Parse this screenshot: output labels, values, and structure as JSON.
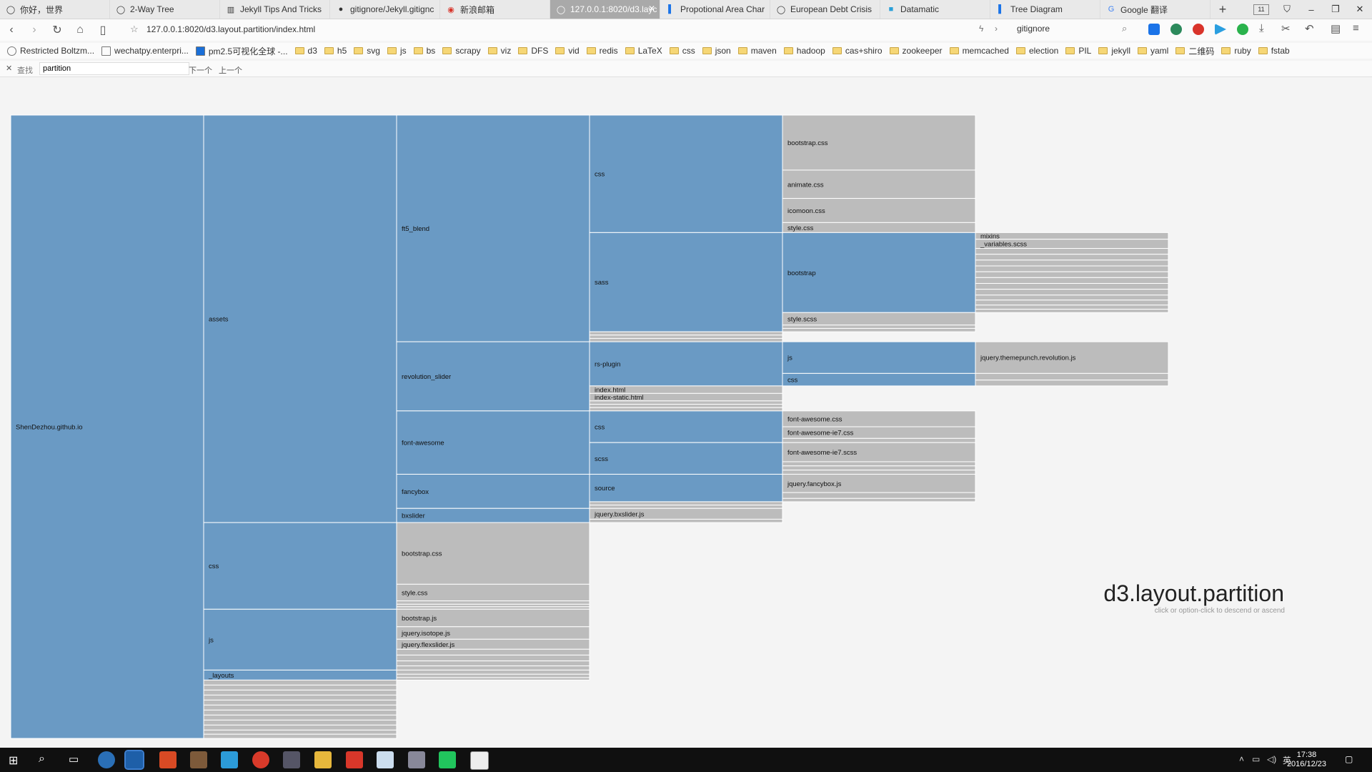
{
  "browser": {
    "tabs": [
      {
        "label": "你好，世界",
        "icon": "globe-icon"
      },
      {
        "label": "2-Way Tree",
        "icon": "globe-icon"
      },
      {
        "label": "Jekyll Tips And Tricks",
        "icon": "book-icon"
      },
      {
        "label": "gitignore/Jekyll.gitignc",
        "icon": "github-icon"
      },
      {
        "label": "新浪邮箱",
        "icon": "weibo-icon"
      },
      {
        "label": "127.0.0.1:8020/d3.layc",
        "icon": "globe-icon",
        "active": true
      },
      {
        "label": "Propotional Area Char",
        "icon": "chart-icon"
      },
      {
        "label": "European Debt Crisis",
        "icon": "globe-icon"
      },
      {
        "label": "Datamatic",
        "icon": "square-icon"
      },
      {
        "label": "Tree Diagram",
        "icon": "chart-icon"
      },
      {
        "label": "Google 翻译",
        "icon": "translate-icon"
      }
    ],
    "tab_count": "11",
    "url": "127.0.0.1:8020/d3.layout.partition/index.html",
    "search_value": "gitignore",
    "bookmarks": [
      "Restricted Boltzm...",
      "wechatpy.enterpri...",
      "pm2.5可视化全球 -...",
      "d3",
      "h5",
      "svg",
      "js",
      "bs",
      "scrapy",
      "viz",
      "DFS",
      "vid",
      "redis",
      "LaTeX",
      "css",
      "json",
      "maven",
      "hadoop",
      "cas+shiro",
      "zookeeper",
      "memcached",
      "election",
      "PIL",
      "jekyll",
      "yaml",
      "二维码",
      "ruby",
      "fstab"
    ]
  },
  "findbar": {
    "label": "查找",
    "value": "partition",
    "next": "下一个",
    "prev": "上一个"
  },
  "page": {
    "title": "d3.layout.partition",
    "subtitle": "click or option-click to descend or ascend"
  },
  "colors": {
    "folder": "#6a9ac4",
    "file": "#bcbcbc",
    "separator": "#ffffff"
  },
  "chart_data": {
    "type": "partition",
    "tree": {
      "name": "ShenDezhou.github.io",
      "children": [
        {
          "name": "assets",
          "children": [
            {
              "name": "ft5_blend",
              "children": [
                {
                  "name": "css",
                  "children": [
                    {
                      "name": "bootstrap.css",
                      "size": 66
                    },
                    {
                      "name": "animate.css",
                      "size": 34
                    },
                    {
                      "name": "icomoon.css",
                      "size": 29
                    },
                    {
                      "name": "style.css",
                      "size": 12
                    }
                  ]
                },
                {
                  "name": "sass",
                  "children": [
                    {
                      "name": "bootstrap",
                      "children": [
                        {
                          "name": "mixins",
                          "size": 8
                        },
                        {
                          "name": "_variables.scss",
                          "size": 11
                        },
                        {
                          "name": "",
                          "size": 7
                        },
                        {
                          "name": "",
                          "size": 7
                        },
                        {
                          "name": "",
                          "size": 7
                        },
                        {
                          "name": "",
                          "size": 7
                        },
                        {
                          "name": "",
                          "size": 7
                        },
                        {
                          "name": "",
                          "size": 7
                        },
                        {
                          "name": "",
                          "size": 7
                        },
                        {
                          "name": "",
                          "size": 7
                        },
                        {
                          "name": "",
                          "size": 6
                        },
                        {
                          "name": "",
                          "size": 6
                        },
                        {
                          "name": "",
                          "size": 5
                        },
                        {
                          "name": "",
                          "size": 4
                        }
                      ]
                    },
                    {
                      "name": "style.scss",
                      "size": 15
                    },
                    {
                      "name": "",
                      "size": 4
                    },
                    {
                      "name": "",
                      "size": 4
                    }
                  ]
                },
                {
                  "name": "",
                  "size": 4
                },
                {
                  "name": "",
                  "size": 4
                },
                {
                  "name": "",
                  "size": 4
                }
              ]
            },
            {
              "name": "revolution_slider",
              "children": [
                {
                  "name": "rs-plugin",
                  "children": [
                    {
                      "name": "js",
                      "children": [
                        {
                          "name": "jquery.themepunch.revolution.js",
                          "size": 38
                        }
                      ]
                    },
                    {
                      "name": "css",
                      "children": [
                        {
                          "name": "",
                          "size": 8
                        },
                        {
                          "name": "",
                          "size": 7
                        }
                      ]
                    }
                  ]
                },
                {
                  "name": "index.html",
                  "size": 9
                },
                {
                  "name": "index-static.html",
                  "size": 9
                },
                {
                  "name": "",
                  "size": 4
                },
                {
                  "name": "",
                  "size": 4
                },
                {
                  "name": "",
                  "size": 4
                }
              ]
            },
            {
              "name": "font-awesome",
              "children": [
                {
                  "name": "css",
                  "children": [
                    {
                      "name": "font-awesome.css",
                      "size": 19
                    },
                    {
                      "name": "font-awesome-ie7.css",
                      "size": 14
                    },
                    {
                      "name": "",
                      "size": 5
                    }
                  ]
                },
                {
                  "name": "scss",
                  "children": [
                    {
                      "name": "font-awesome-ie7.scss",
                      "size": 23
                    },
                    {
                      "name": "",
                      "size": 5
                    },
                    {
                      "name": "",
                      "size": 5
                    },
                    {
                      "name": "",
                      "size": 5
                    }
                  ]
                }
              ]
            },
            {
              "name": "fancybox",
              "children": [
                {
                  "name": "source",
                  "children": [
                    {
                      "name": "jquery.fancybox.js",
                      "size": 22
                    },
                    {
                      "name": "",
                      "size": 7
                    },
                    {
                      "name": "",
                      "size": 4
                    }
                  ]
                },
                {
                  "name": "",
                  "size": 4
                },
                {
                  "name": "",
                  "size": 4
                }
              ]
            },
            {
              "name": "bxslider",
              "children": [
                {
                  "name": "jquery.bxslider.js",
                  "size": 13
                },
                {
                  "name": "",
                  "size": 4
                }
              ]
            }
          ]
        },
        {
          "name": "css",
          "children": [
            {
              "name": "bootstrap.css",
              "size": 74
            },
            {
              "name": "style.css",
              "size": 20
            },
            {
              "name": "",
              "size": 4
            },
            {
              "name": "",
              "size": 3
            },
            {
              "name": "",
              "size": 3
            }
          ]
        },
        {
          "name": "js",
          "children": [
            {
              "name": "bootstrap.js",
              "size": 21
            },
            {
              "name": "jquery.isotope.js",
              "size": 15
            },
            {
              "name": "jquery.flexslider.js",
              "size": 12
            },
            {
              "name": "",
              "size": 7
            },
            {
              "name": "",
              "size": 7
            },
            {
              "name": "",
              "size": 6
            },
            {
              "name": "",
              "size": 5
            }
          ]
        },
        {
          "name": "_layouts",
          "children": [
            {
              "name": "",
              "size": 5
            },
            {
              "name": "",
              "size": 4
            },
            {
              "name": "",
              "size": 3
            }
          ]
        },
        {
          "name": "",
          "size": 6
        },
        {
          "name": "",
          "size": 6
        },
        {
          "name": "",
          "size": 6
        },
        {
          "name": "",
          "size": 6
        },
        {
          "name": "",
          "size": 6
        },
        {
          "name": "",
          "size": 6
        },
        {
          "name": "",
          "size": 6
        },
        {
          "name": "",
          "size": 6
        },
        {
          "name": "",
          "size": 6
        },
        {
          "name": "",
          "size": 6
        },
        {
          "name": "",
          "size": 5
        },
        {
          "name": "",
          "size": 5
        }
      ]
    }
  },
  "taskbar": {
    "time": "17:38",
    "date": "2016/12/23",
    "lang": "英"
  }
}
